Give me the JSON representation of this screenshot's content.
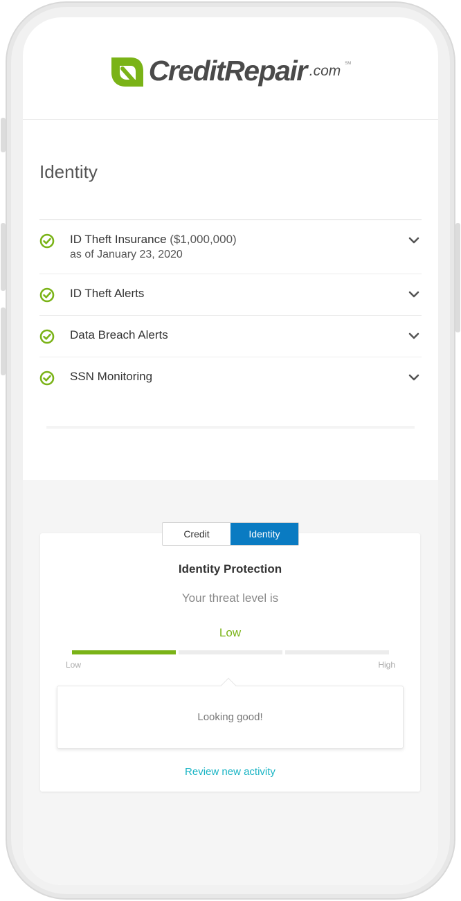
{
  "brand": {
    "name": "CreditRepair",
    "suffix": ".com",
    "mark": "SM",
    "colors": {
      "green": "#7ab317",
      "dark": "#4a4a4a",
      "accent": "#0a7bc2",
      "link": "#19b4c4"
    }
  },
  "identity": {
    "title": "Identity",
    "items": [
      {
        "label": "ID Theft Insurance",
        "detail": "($1,000,000)",
        "sub": "as of January 23, 2020",
        "icon": "check-circle-icon"
      },
      {
        "label": "ID Theft Alerts",
        "detail": "",
        "sub": "",
        "icon": "check-circle-icon"
      },
      {
        "label": "Data Breach Alerts",
        "detail": "",
        "sub": "",
        "icon": "check-circle-icon"
      },
      {
        "label": "SSN Monitoring",
        "detail": "",
        "sub": "",
        "icon": "check-circle-icon"
      }
    ]
  },
  "protection": {
    "tabs": [
      "Credit",
      "Identity"
    ],
    "active_tab": "Identity",
    "title": "Identity Protection",
    "threat_label": "Your threat level is",
    "threat_value": "Low",
    "meter": {
      "level": 1,
      "segments": 3,
      "low_label": "Low",
      "high_label": "High"
    },
    "message": "Looking good!",
    "link": "Review new activity"
  }
}
